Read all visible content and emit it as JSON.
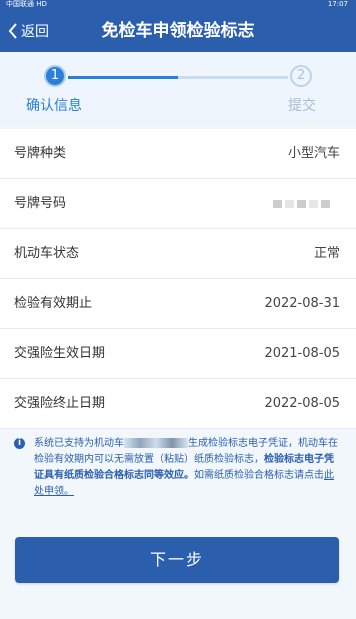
{
  "status_bar": {
    "carrier": "中国联通 HD",
    "time": "17:07"
  },
  "header": {
    "back_label": "返回",
    "title": "免检车申领检验标志"
  },
  "steps": [
    {
      "number": "1",
      "label": "确认信息"
    },
    {
      "number": "2",
      "label": "提交"
    }
  ],
  "info_rows": [
    {
      "label": "号牌种类",
      "value": "小型汽车"
    },
    {
      "label": "号牌号码",
      "value": ""
    },
    {
      "label": "机动车状态",
      "value": "正常"
    },
    {
      "label": "检验有效期止",
      "value": "2022-08-31"
    },
    {
      "label": "交强险生效日期",
      "value": "2021-08-05"
    },
    {
      "label": "交强险终止日期",
      "value": "2022-08-05"
    }
  ],
  "notice": {
    "part1": "系统已支持为机动车",
    "part2": "生成检验标志电子凭证，机动车在检验有效期内可以无需放置（粘贴）纸质检验标志，",
    "bold": "检验标志电子凭证具有纸质检验合格标志同等效应。",
    "part3": "如需纸质检验合格标志请点击",
    "link": "此处申领。"
  },
  "next_button": "下一步",
  "colors": {
    "primary": "#2b5fae",
    "accent": "#2c7fd6",
    "background": "#f2f7fc"
  }
}
